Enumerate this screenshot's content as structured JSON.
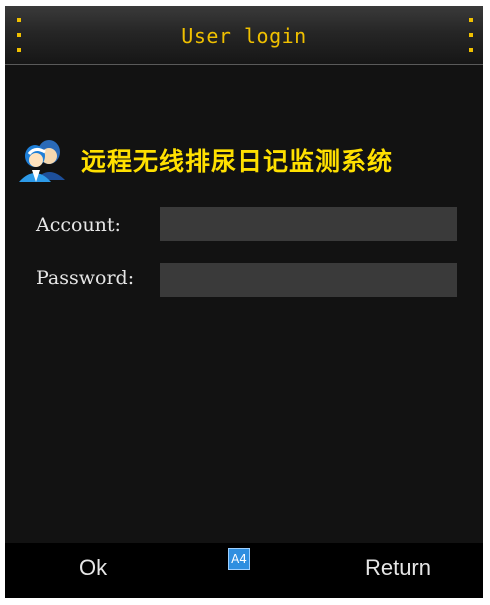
{
  "header": {
    "title": "User login"
  },
  "banner": {
    "logo_icon": "users-icon",
    "system_name": "远程无线排尿日记监测系统"
  },
  "form": {
    "account_label": "Account:",
    "account_value": "",
    "password_label": "Password:",
    "password_value": ""
  },
  "softkeys": {
    "left": "Ok",
    "center_badge": "A4",
    "right": "Return"
  },
  "colors": {
    "accent": "#f0c000",
    "banner_text": "#ffe000",
    "background": "#121212",
    "input_bg": "#3a3a3a"
  }
}
